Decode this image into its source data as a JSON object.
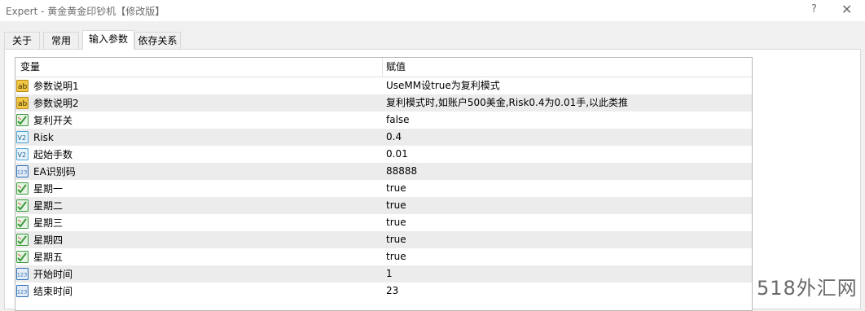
{
  "window": {
    "title": "Expert - 黄金黄金印钞机【修改版】",
    "help": "?",
    "close": "✕"
  },
  "tabs": [
    {
      "label": "关于"
    },
    {
      "label": "常用"
    },
    {
      "label": "输入参数",
      "active": true
    },
    {
      "label": "依存关系"
    }
  ],
  "table": {
    "headers": {
      "variable": "变量",
      "value": "赋值"
    },
    "rows": [
      {
        "icon": "string-type-icon",
        "name": "参数说明1",
        "value": "UseMM设true为复利模式"
      },
      {
        "icon": "string-type-icon",
        "name": "参数说明2",
        "value": "复利模式时,如账户500美金,Risk0.4为0.01手,以此类推"
      },
      {
        "icon": "bool-type-icon",
        "name": "复利开关",
        "value": "false"
      },
      {
        "icon": "double-type-icon",
        "name": "Risk",
        "value": "0.4"
      },
      {
        "icon": "double-type-icon",
        "name": "起始手数",
        "value": "0.01"
      },
      {
        "icon": "int-type-icon",
        "name": "EA识别码",
        "value": "88888"
      },
      {
        "icon": "bool-type-icon",
        "name": "星期一",
        "value": "true"
      },
      {
        "icon": "bool-type-icon",
        "name": "星期二",
        "value": "true"
      },
      {
        "icon": "bool-type-icon",
        "name": "星期三",
        "value": "true"
      },
      {
        "icon": "bool-type-icon",
        "name": "星期四",
        "value": "true"
      },
      {
        "icon": "bool-type-icon",
        "name": "星期五",
        "value": "true"
      },
      {
        "icon": "int-type-icon",
        "name": "开始时间",
        "value": "1"
      },
      {
        "icon": "int-type-icon",
        "name": "结束时间",
        "value": "23"
      }
    ]
  },
  "watermark": "518外汇网",
  "icon_labels": {
    "string": "ab",
    "double": "V2",
    "int": "123"
  },
  "colors": {
    "string_icon": "#f2c744",
    "bool_icon": "#3a9a3a",
    "double_icon": "#4aa3d8",
    "int_icon": "#2f6fb5",
    "alt_row": "#ececec"
  }
}
